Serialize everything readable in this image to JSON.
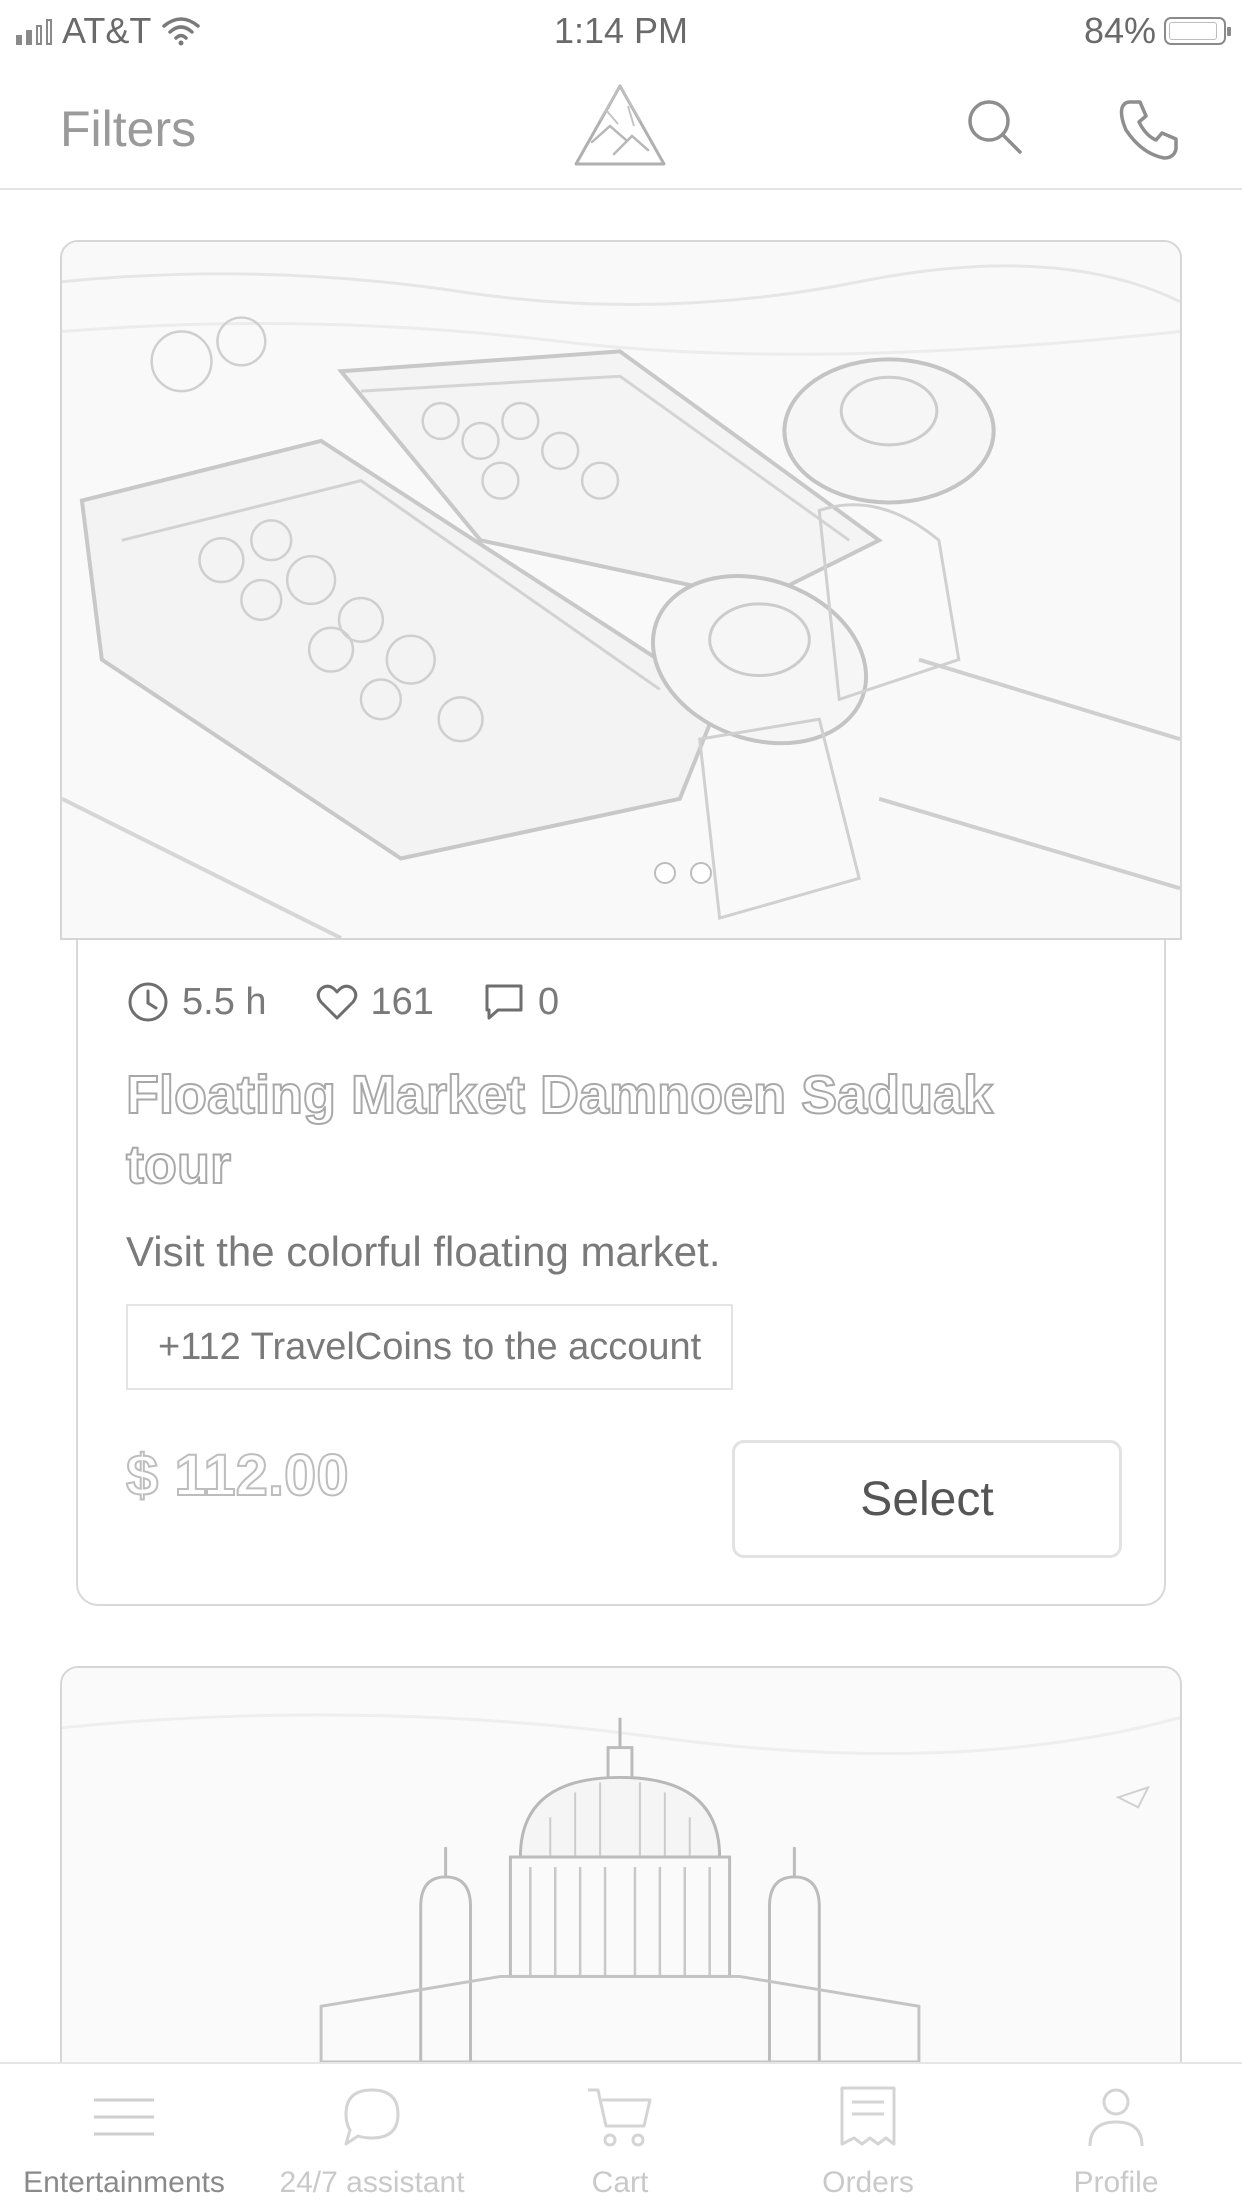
{
  "status_bar": {
    "carrier": "AT&T",
    "time": "1:14 PM",
    "battery": "84%"
  },
  "header": {
    "filters_label": "Filters",
    "logo": "triangle-logo-icon",
    "search_icon": "search-icon",
    "phone_icon": "phone-icon"
  },
  "tours": [
    {
      "image": "floating-market-photo",
      "carousel_pages": 2,
      "duration": "5.5 h",
      "likes": "161",
      "comments": "0",
      "title": "Floating Market Damnoen Saduak tour",
      "description": "Visit the colorful floating market.",
      "coins": "+112 TravelCoins to the account",
      "price": "$ 112.00",
      "select_label": "Select"
    },
    {
      "image": "cathedral-dome-photo"
    }
  ],
  "tab_bar": {
    "active": "Entertainments",
    "items": [
      {
        "label": "Entertainments",
        "icon": "menu-icon"
      },
      {
        "label": "24/7 assistant",
        "icon": "chat-bubble-icon"
      },
      {
        "label": "Cart",
        "icon": "cart-icon"
      },
      {
        "label": "Orders",
        "icon": "receipt-icon"
      },
      {
        "label": "Profile",
        "icon": "person-icon"
      }
    ]
  }
}
